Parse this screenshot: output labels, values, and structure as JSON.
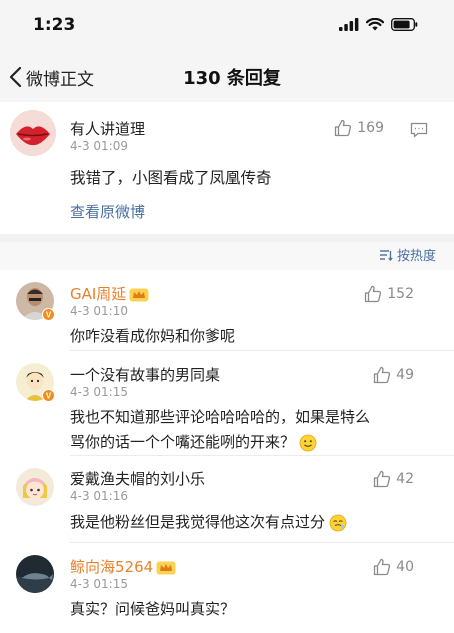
{
  "status": {
    "time": "1:23"
  },
  "nav": {
    "back_label": "微博正文",
    "title": "130 条回复"
  },
  "main_post": {
    "author": "有人讲道理",
    "time": "4-3 01:09",
    "likes": "169",
    "text": "我错了，小图看成了凤凰传奇",
    "view_original": "查看原微博"
  },
  "sort": {
    "label": "按热度"
  },
  "comments": [
    {
      "author": "GAI周延",
      "time": "4-3 01:10",
      "likes": "152",
      "text": "你咋没看成你妈和你爹呢"
    },
    {
      "author": "一个没有故事的男同桌",
      "time": "4-3 01:15",
      "likes": "49",
      "text_line1": "我也不知道那些评论哈哈哈哈的，如果是特么",
      "text_line2": "骂你的话一个个嘴还能咧的开来？"
    },
    {
      "author": "爱戴渔夫帽的刘小乐",
      "time": "4-3 01:16",
      "likes": "42",
      "text": "我是他粉丝但是我觉得他这次有点过分"
    },
    {
      "author": "鲸向海5264",
      "time": "4-3 01:15",
      "likes": "40",
      "text": "真实？问候爸妈叫真实？"
    }
  ],
  "colors": {
    "link": "#4a6fa0",
    "vip_name": "#e8812a",
    "muted": "#9a9a9a"
  }
}
